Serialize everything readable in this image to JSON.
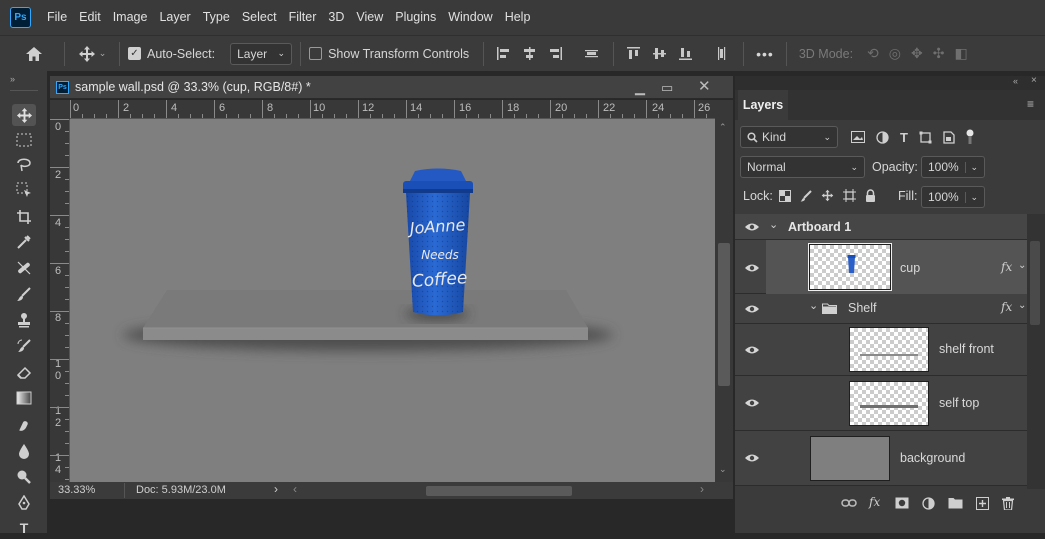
{
  "app": {
    "logo": "Ps"
  },
  "menu": [
    "File",
    "Edit",
    "Image",
    "Layer",
    "Type",
    "Select",
    "Filter",
    "3D",
    "View",
    "Plugins",
    "Window",
    "Help"
  ],
  "options": {
    "auto_select_label": "Auto-Select:",
    "auto_select_checked": true,
    "auto_select_target": "Layer",
    "transform_controls_label": "Show Transform Controls",
    "transform_controls_checked": false,
    "more_label": "•••",
    "mode_3d_label": "3D Mode:"
  },
  "document": {
    "title": "sample wall.psd @ 33.3% (cup, RGB/8#) *",
    "zoom": "33.33%",
    "doc_size": "Doc: 5.93M/23.0M",
    "hruler": [
      "0",
      "2",
      "4",
      "6",
      "8",
      "10",
      "12",
      "14",
      "16",
      "18",
      "20",
      "22",
      "24",
      "26"
    ],
    "vruler": [
      "0",
      "2",
      "4",
      "6",
      "8",
      "1 0",
      "1 2",
      "1 4"
    ],
    "cup_text": [
      "JoAnne",
      "Needs",
      "Coffee"
    ]
  },
  "layers_panel": {
    "tab": "Layers",
    "filter": "Kind",
    "blend_mode": "Normal",
    "opacity_label": "Opacity:",
    "opacity": "100%",
    "lock_label": "Lock:",
    "fill_label": "Fill:",
    "fill": "100%",
    "layers": [
      {
        "name": "Artboard 1",
        "kind": "artboard"
      },
      {
        "name": "cup",
        "kind": "layer",
        "fx": "fx",
        "selected": true
      },
      {
        "name": "Shelf",
        "kind": "group",
        "fx": "fx"
      },
      {
        "name": "shelf front",
        "kind": "layer"
      },
      {
        "name": "self top",
        "kind": "layer"
      },
      {
        "name": "background",
        "kind": "layer"
      }
    ]
  },
  "colors": {
    "accent": "#31a8ff",
    "cup_blue": "#1f5cc0",
    "canvas_gray": "#7f7f7f"
  }
}
